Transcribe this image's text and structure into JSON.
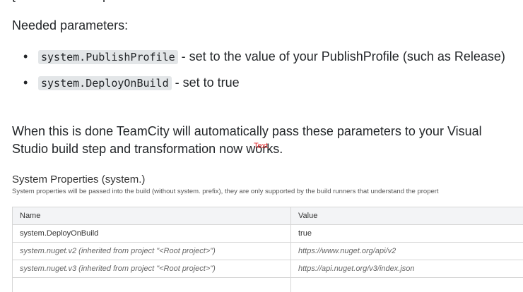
{
  "top_fragment_left": "t",
  "top_fragment_right": "r",
  "intro_text": "Needed parameters:",
  "params": [
    {
      "code": "system.PublishProfile",
      "desc": " - set to the value of your PublishProfile (such as Release)"
    },
    {
      "code": "system.DeployOnBuild",
      "desc": " - set to true"
    }
  ],
  "conclusion_text": "When this is done TeamCity will automatically pass these parameters to your Visual Studio build step and transformation now works.",
  "overlay_text": "Text",
  "panel": {
    "title": "System Properties (system.)",
    "description": "System properties will be passed into the build (without system. prefix), they are only supported by the build runners that understand the propert",
    "columns": [
      "Name",
      "Value"
    ],
    "rows": [
      {
        "name": "system.DeployOnBuild",
        "value": "true"
      },
      {
        "name": "system.nuget.v2 (inherited from project \"<Root project>\")",
        "value": "https://www.nuget.org/api/v2"
      },
      {
        "name": "system.nuget.v3 (inherited from project \"<Root project>\")",
        "value": "https://api.nuget.org/v3/index.json"
      }
    ]
  }
}
